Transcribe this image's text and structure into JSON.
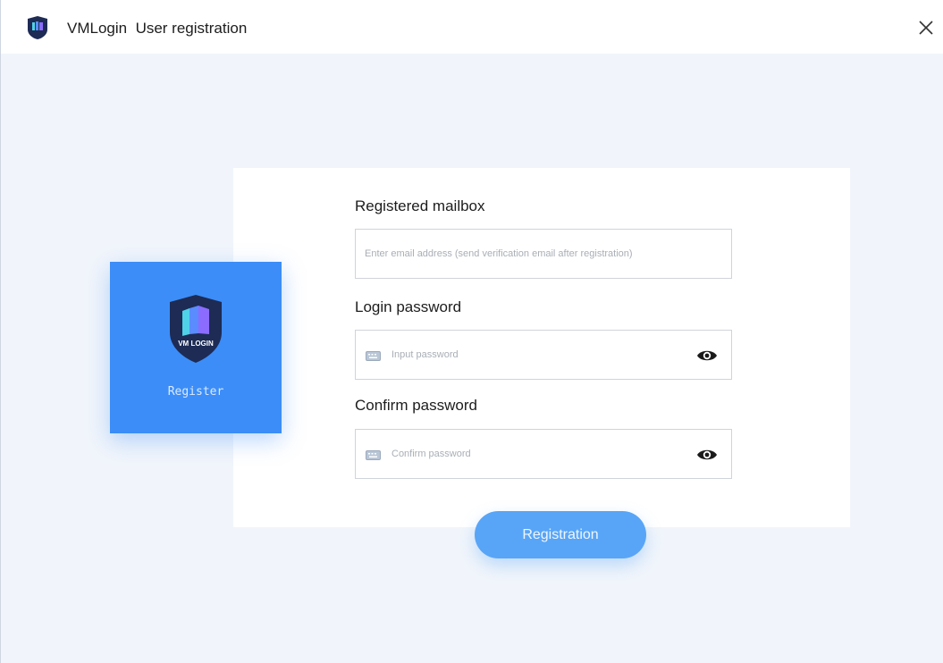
{
  "window": {
    "app_name": "VMLogin",
    "title": "User registration"
  },
  "panel": {
    "logo_text": "VM LOGIN",
    "label": "Register"
  },
  "form": {
    "email": {
      "label": "Registered mailbox",
      "placeholder": "Enter email address (send verification email after registration)",
      "value": ""
    },
    "password": {
      "label": "Login password",
      "placeholder": "Input password",
      "value": ""
    },
    "confirm": {
      "label": "Confirm password",
      "placeholder": "Confirm password",
      "value": ""
    },
    "submit_label": "Registration"
  },
  "icons": {
    "app": "vmlogin-logo-icon",
    "close": "close-icon",
    "keyboard": "keyboard-icon",
    "eye": "eye-icon"
  },
  "colors": {
    "accent": "#3c8df7",
    "button": "#58a5f7",
    "background": "#f1f5fb",
    "logo_dark": "#1d2b55"
  }
}
